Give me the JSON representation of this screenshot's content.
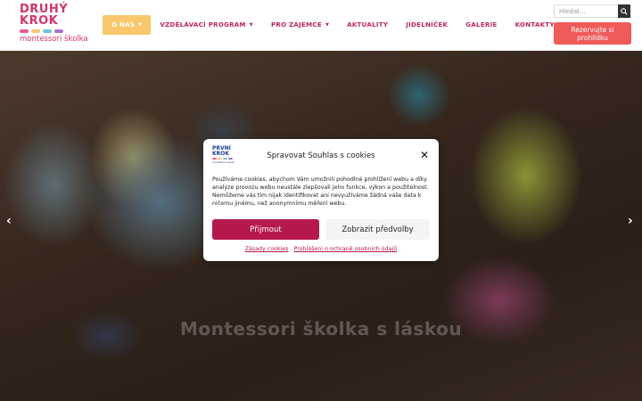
{
  "logo": {
    "line1": "DRUHÝ",
    "line2": "KROK",
    "line3": "montessori školka",
    "dot_colors": [
      "#ef5a8f",
      "#f9c86a",
      "#6fc2e0",
      "#a276c9"
    ]
  },
  "nav": {
    "items": [
      {
        "label": "O NÁS",
        "has_dropdown": true,
        "active": true
      },
      {
        "label": "VZDĚLÁVACÍ PROGRAM",
        "has_dropdown": true
      },
      {
        "label": "PRO ZÁJEMCE",
        "has_dropdown": true
      },
      {
        "label": "AKTUALITY",
        "has_dropdown": false
      },
      {
        "label": "JÍDELNÍČEK",
        "has_dropdown": false
      },
      {
        "label": "GALERIE",
        "has_dropdown": false
      },
      {
        "label": "KONTAKTY",
        "has_dropdown": true
      }
    ],
    "caret": "▼",
    "language_flag": "uk-flag-icon"
  },
  "search": {
    "placeholder": "Hledat..."
  },
  "reserve_button": "Rezervujte si prohlídku",
  "hero": {
    "caption": "Montessori školka s láskou",
    "prev_icon": "‹",
    "next_icon": "›"
  },
  "cookie_modal": {
    "logo": {
      "line1": "PRVNÍ",
      "line2": "KROK",
      "line3": "montessori jesle"
    },
    "title": "Spravovat Souhlas s cookies",
    "close": "✕",
    "text": "Používáme cookies, abychom Vám umožnili pohodlné prohlížení webu a díky analýze provozu webu neustále zlepšovali jeho funkce, výkon a použitelnost. Nemůžeme vás tím nijak identifikovat ani nevyužíváme žádná vaše data k ničemu jinému, než anonymnímu měření webu.",
    "accept": "Přijmout",
    "preferences": "Zobrazit předvolby",
    "links": [
      "Zásady cookies",
      "Prohlášení o ochraně osobních údajů"
    ]
  },
  "colors": {
    "brand": "#d6336c",
    "accent": "#f9c86a",
    "accept": "#b5174f",
    "reserve": "#ef5a5a"
  }
}
